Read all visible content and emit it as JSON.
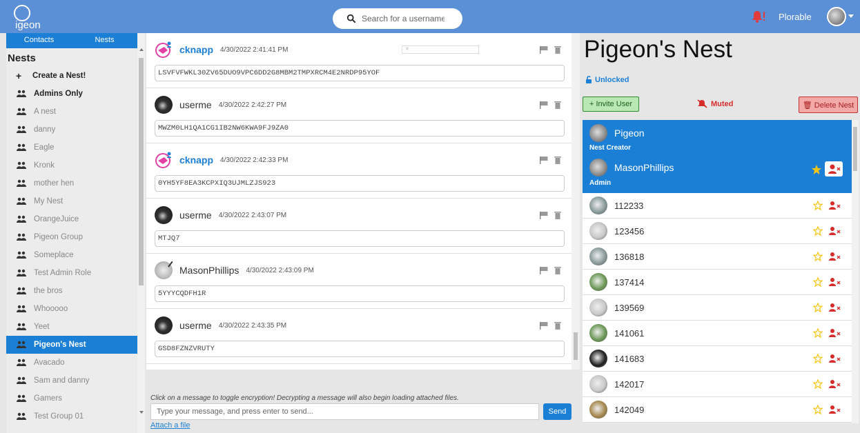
{
  "topbar": {
    "logo_text": "igeon",
    "search_placeholder": "Search for a username...",
    "user_name": "Plorable"
  },
  "sidebar": {
    "tabs": [
      "Contacts",
      "Nests"
    ],
    "title": "Nests",
    "create_label": "Create a Nest!",
    "items": [
      {
        "label": "Admins Only",
        "style": "bold"
      },
      {
        "label": "A nest",
        "style": "normal"
      },
      {
        "label": "danny",
        "style": "normal"
      },
      {
        "label": "Eagle",
        "style": "normal"
      },
      {
        "label": "Kronk",
        "style": "normal"
      },
      {
        "label": "mother hen",
        "style": "normal"
      },
      {
        "label": "My Nest",
        "style": "normal"
      },
      {
        "label": "OrangeJuice",
        "style": "normal"
      },
      {
        "label": "Pigeon Group",
        "style": "normal"
      },
      {
        "label": "Someplace",
        "style": "normal"
      },
      {
        "label": "Test Admin Role",
        "style": "normal"
      },
      {
        "label": "the bros",
        "style": "normal"
      },
      {
        "label": "Whooooo",
        "style": "normal"
      },
      {
        "label": "Yeet",
        "style": "normal"
      },
      {
        "label": "Pigeon's Nest",
        "style": "active"
      },
      {
        "label": "Avacado",
        "style": "normal"
      },
      {
        "label": "Sam and danny",
        "style": "normal"
      },
      {
        "label": "Gamers",
        "style": "normal"
      },
      {
        "label": "Test Group 01",
        "style": "normal"
      }
    ]
  },
  "chat": {
    "messages": [
      {
        "author": "cknapp",
        "avatar": "pink",
        "time": "4/30/2022 2:41:41 PM",
        "body": "LSVFVFWKL30ZV65DUO9VPC6DD2G8MBM2TMPXRCM4E2NRDP95YOF"
      },
      {
        "author": "userme",
        "avatar": "dark",
        "time": "4/30/2022 2:42:27 PM",
        "body": "MWZM0LH1QA1CG1IB2NW6KWA9FJ9ZA0"
      },
      {
        "author": "cknapp",
        "avatar": "pink",
        "time": "4/30/2022 2:42:33 PM",
        "body": "0YH5YF8EA3KCPXIQ3UJMLZJS923"
      },
      {
        "author": "userme",
        "avatar": "dark",
        "time": "4/30/2022 2:43:07 PM",
        "body": "MTJQ7"
      },
      {
        "author": "MasonPhillips",
        "avatar": "light",
        "time": "4/30/2022 2:43:09 PM",
        "body": "5YYYCQDFH1R"
      },
      {
        "author": "userme",
        "avatar": "dark",
        "time": "4/30/2022 2:43:35 PM",
        "body": "GSD8FZNZVRUTY"
      }
    ],
    "hint": "Click on a message to toggle encryption! Decrypting a message will also begin loading attached files.",
    "input_placeholder": "Type your message, and press enter to send...",
    "send_label": "Send",
    "attach_label": "Attach a file"
  },
  "nest": {
    "title": "Pigeon's Nest",
    "lock_status": "Unlocked",
    "invite_label": "+ Invite User",
    "muted_label": "Muted",
    "delete_label": "Delete Nest",
    "creator": {
      "name": "Pigeon",
      "role": "Nest Creator"
    },
    "admin": {
      "name": "MasonPhillips",
      "role": "Admin"
    },
    "members": [
      "112233",
      "123456",
      "136818",
      "137414",
      "139569",
      "141061",
      "141683",
      "142017",
      "142049"
    ]
  },
  "colors": {
    "topbar": "#5b8fd6",
    "accent": "#1b7fd6",
    "invite_bg": "#b9e8b4",
    "delete_bg": "#f4a9a9",
    "danger": "#d62c2c",
    "star": "#f5c518"
  }
}
